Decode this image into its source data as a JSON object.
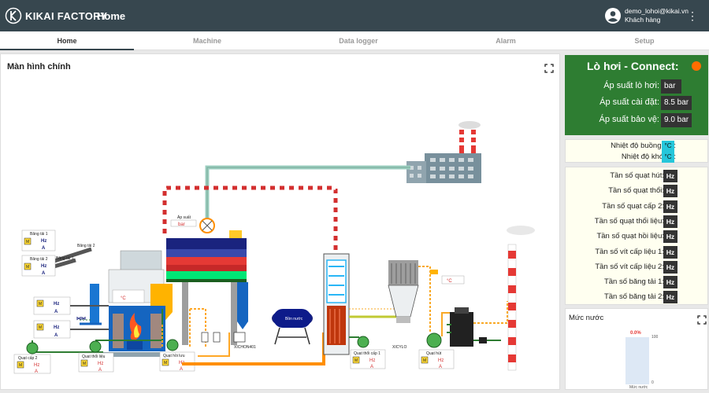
{
  "app": {
    "brand": "KIKAI FACTORY",
    "title": "Home"
  },
  "user": {
    "email": "demo_lohoi@kikai.vn",
    "role": "Khách hàng"
  },
  "tabs": [
    {
      "label": "Home",
      "active": true
    },
    {
      "label": "Machine"
    },
    {
      "label": "Data logger"
    },
    {
      "label": "Alarm"
    },
    {
      "label": "Setup"
    }
  ],
  "main": {
    "title": "Màn hình chính"
  },
  "boiler": {
    "title": "Lò hơi - Connect:",
    "status_color": "#ff6d00",
    "rows": [
      {
        "label": "Áp suất lò hơi:",
        "value": "bar"
      },
      {
        "label": "Áp suất cài đặt:",
        "value": "8.5 bar"
      },
      {
        "label": "Áp suất bảo vệ:",
        "value": "9.0 bar"
      }
    ]
  },
  "temps": [
    {
      "label": "Nhiệt độ buồng đốt:",
      "unit": "°C"
    },
    {
      "label": "Nhiệt độ khói ra:",
      "unit": "°C"
    }
  ],
  "frequencies": [
    {
      "label": "Tần số quạt hút:",
      "unit": "Hz"
    },
    {
      "label": "Tần số quạt thổi:",
      "unit": "Hz"
    },
    {
      "label": "Tần số quạt cấp 2:",
      "unit": "Hz"
    },
    {
      "label": "Tần số quạt thổi liệu:",
      "unit": "Hz"
    },
    {
      "label": "Tần số quạt hồi liệu:",
      "unit": "Hz"
    },
    {
      "label": "Tần số vít cấp liệu 1:",
      "unit": "Hz"
    },
    {
      "label": "Tần số vít cấp liệu 2:",
      "unit": "Hz"
    },
    {
      "label": "Tần số băng tải 1:",
      "unit": "Hz"
    },
    {
      "label": "Tần số băng tải 2:",
      "unit": "Hz"
    }
  ],
  "water": {
    "title": "Mức nước",
    "percent": "0.0%",
    "level": 0.0,
    "scale_max": "100",
    "scale_min": "0",
    "label": "Mức nước"
  },
  "diagram": {
    "conveyor1": "Băng tải 1",
    "conveyor2": "Băng tải 2",
    "conveyor1b": "Băng tải 1",
    "conveyor2b": "Băng tải 2",
    "pressure_label": "Áp suất",
    "pressure_unit": "bar",
    "temp_unit": "°C",
    "hz": "Hz",
    "amp": "A",
    "motor": "M",
    "fan_supply2": "Quạt cấp 2",
    "fan_blow_fuel": "Quạt thổi liệu",
    "fan_return": "Quạt hồi lưu",
    "fan_blow1": "Quạt thổi cấp 1",
    "fan_exhaust": "Quạt hút",
    "drum": "Bồn nước",
    "cyclone": "XICYLO",
    "cyclone2": "XICHON401"
  }
}
